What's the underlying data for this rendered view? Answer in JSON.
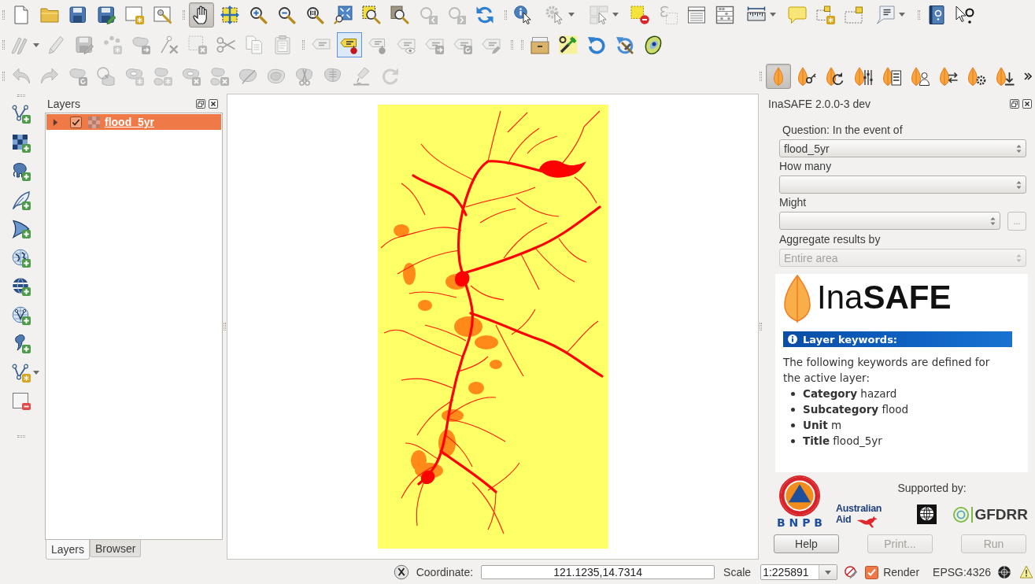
{
  "toolbars": [
    {
      "buttons": [
        {
          "selected": false,
          "disabled": false
        },
        {
          "selected": false,
          "disabled": false
        },
        {
          "selected": false,
          "disabled": false
        },
        {
          "selected": false,
          "disabled": false
        },
        {
          "selected": false,
          "disabled": false
        },
        {
          "selected": false,
          "disabled": false
        }
      ]
    },
    {
      "buttons": [
        {
          "selected": true,
          "disabled": false
        },
        {
          "selected": false,
          "disabled": false
        },
        {
          "selected": false,
          "disabled": false
        },
        {
          "selected": false,
          "disabled": false
        },
        {
          "selected": false,
          "disabled": false
        },
        {
          "selected": false,
          "disabled": false
        },
        {
          "selected": false,
          "disabled": false
        },
        {
          "selected": false,
          "disabled": false
        },
        {
          "selected": false,
          "disabled": true
        },
        {
          "selected": false,
          "disabled": true
        },
        {
          "selected": false,
          "disabled": false
        }
      ]
    },
    {
      "buttons": [
        {
          "selected": false,
          "disabled": false
        },
        {
          "selected": false,
          "disabled": true
        },
        {
          "selected": false,
          "disabled": true
        },
        {
          "selected": false,
          "disabled": false
        },
        {
          "selected": false,
          "disabled": true
        },
        {
          "selected": false,
          "disabled": false
        },
        {
          "selected": false,
          "disabled": false
        },
        {
          "selected": false,
          "disabled": false
        },
        {
          "selected": false,
          "disabled": false
        },
        {
          "selected": false,
          "disabled": false
        },
        {
          "selected": false,
          "disabled": false
        },
        {
          "selected": false,
          "disabled": false
        }
      ]
    },
    {
      "buttons": [
        {
          "selected": false,
          "disabled": false
        },
        {
          "selected": false,
          "disabled": false
        }
      ]
    },
    {
      "buttons": [
        {
          "selected": false,
          "disabled": true
        },
        {
          "selected": false,
          "disabled": true
        },
        {
          "selected": false,
          "disabled": true
        },
        {
          "selected": false,
          "disabled": true
        },
        {
          "selected": false,
          "disabled": true
        },
        {
          "selected": false,
          "disabled": true
        },
        {
          "selected": false,
          "disabled": true
        },
        {
          "selected": false,
          "disabled": true
        },
        {
          "selected": false,
          "disabled": true
        },
        {
          "selected": false,
          "disabled": true
        }
      ]
    },
    {
      "buttons": [
        {
          "selected": false,
          "disabled": true
        },
        {
          "selected": true,
          "disabled": false
        },
        {
          "selected": false,
          "disabled": true
        },
        {
          "selected": false,
          "disabled": true
        },
        {
          "selected": false,
          "disabled": true
        },
        {
          "selected": false,
          "disabled": true
        },
        {
          "selected": false,
          "disabled": true
        }
      ]
    },
    {
      "buttons": [
        {
          "selected": false,
          "disabled": false
        },
        {
          "selected": false,
          "disabled": false
        },
        {
          "selected": false,
          "disabled": false
        },
        {
          "selected": false,
          "disabled": false
        },
        {
          "selected": false,
          "disabled": false
        }
      ]
    },
    {
      "buttons": [
        {
          "selected": false,
          "disabled": true
        },
        {
          "selected": false,
          "disabled": true
        },
        {
          "selected": false,
          "disabled": true
        },
        {
          "selected": false,
          "disabled": true
        },
        {
          "selected": false,
          "disabled": true
        },
        {
          "selected": false,
          "disabled": true
        },
        {
          "selected": false,
          "disabled": true
        },
        {
          "selected": false,
          "disabled": true
        },
        {
          "selected": false,
          "disabled": true
        },
        {
          "selected": false,
          "disabled": true
        },
        {
          "selected": false,
          "disabled": true
        },
        {
          "selected": false,
          "disabled": true
        },
        {
          "selected": false,
          "disabled": true
        },
        {
          "selected": false,
          "disabled": true
        }
      ]
    },
    {
      "buttons": [
        {
          "selected": true,
          "disabled": false
        },
        {
          "selected": false,
          "disabled": false
        },
        {
          "selected": false,
          "disabled": false
        },
        {
          "selected": false,
          "disabled": false
        },
        {
          "selected": false,
          "disabled": false
        },
        {
          "selected": false,
          "disabled": false
        },
        {
          "selected": false,
          "disabled": false
        },
        {
          "selected": false,
          "disabled": false
        },
        {
          "selected": false,
          "disabled": false
        }
      ]
    }
  ],
  "layers_panel": {
    "title": "Layers",
    "layers": [
      {
        "name": "flood_5yr",
        "selected": true,
        "checked": true,
        "expanded": false
      }
    ],
    "tabs": [
      {
        "label": "Layers",
        "selected": true
      },
      {
        "label": "Browser",
        "selected": false
      }
    ]
  },
  "inasafe_panel": {
    "title": "InaSAFE 2.0.0-3 dev",
    "fields": [
      {
        "label": "Question: In the event of",
        "value": "flood_5yr",
        "disabled": false
      },
      {
        "label": "How many",
        "disabled": false
      },
      {
        "label": "Might",
        "disabled": false,
        "browse_button": "..."
      },
      {
        "label": "Aggregate results by",
        "value": "Entire area",
        "disabled": true
      }
    ],
    "report": {
      "logo_text": "Ina**SAFE**",
      "heading": "Layer keywords:",
      "intro": "The following keywords are defined for the active layer:",
      "keywords": [
        "**Category** hazard",
        "**Subcategory** flood",
        "**Unit** m",
        "**Title** flood_5yr"
      ]
    },
    "agency_logo": {
      "initials": "B N P B"
    },
    "supported_by": {
      "label": "Supported by:",
      "logos": [
        {
          "kind": "aid",
          "lines": [
            "Australian",
            "Aid"
          ]
        },
        {
          "kind": "worldbank"
        },
        {
          "kind": "gfdrr",
          "text": "GFDRR"
        }
      ]
    },
    "buttons": [
      {
        "label": "Help",
        "disabled": false
      },
      {
        "label": "Print...",
        "disabled": true
      },
      {
        "label": "Run",
        "disabled": true
      }
    ]
  },
  "status_bar": {
    "coordinate_label": "Coordinate:",
    "coordinate": "121.1235,14.7314",
    "scale_label": "Scale",
    "scale": "1:225891",
    "render": {
      "label": "Render",
      "checked": true
    },
    "crs": "EPSG:4326"
  }
}
